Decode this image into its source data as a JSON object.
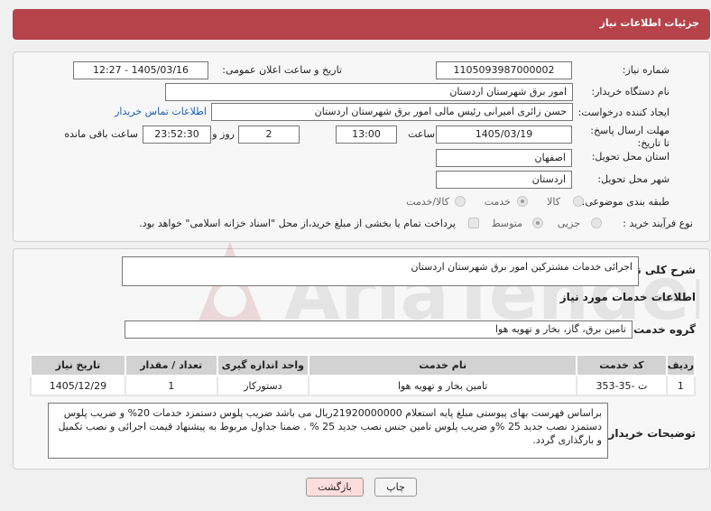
{
  "header": {
    "title": "جزئیات اطلاعات نیاز"
  },
  "form": {
    "need_number_label": "شماره نیاز:",
    "need_number": "1105093987000002",
    "announce_label": "تاریخ و ساعت اعلان عمومی:",
    "announce_value": "1405/03/16 - 12:27",
    "buyer_org_label": "نام دستگاه خریدار:",
    "buyer_org": "امور برق شهرستان اردستان",
    "requester_label": "ایجاد کننده درخواست:",
    "requester": "حسن زائری امیرانی رئیس مالی امور برق شهرستان اردستان",
    "contact_link": "اطلاعات تماس خریدار",
    "deadline_label": "مهلت ارسال پاسخ: تا تاریخ:",
    "deadline_date": "1405/03/19",
    "time_label": "ساعت",
    "deadline_time": "13:00",
    "days_value": "2",
    "days_label": "روز و",
    "remaining_time": "23:52:30",
    "remaining_label": "ساعت باقی مانده",
    "province_label": "استان محل تحویل:",
    "province": "اصفهان",
    "city_label": "شهر محل تحویل:",
    "city": "اردستان",
    "category_label": "طبقه بندی موضوعی:",
    "category_options": [
      "کالا",
      "خدمت",
      "کالا/خدمت"
    ],
    "process_label": "نوع فرآیند خرید :",
    "process_options": [
      "جزیی",
      "متوسط"
    ],
    "payment_text": "پرداخت تمام یا بخشی از مبلغ خرید،از محل \"اسناد خزانه اسلامی\" خواهد بود."
  },
  "summary": {
    "label": "شرح کلی نیاز:",
    "value": "اجرائی خدمات مشترکین امور برق شهرستان اردستان"
  },
  "services": {
    "section_title": "اطلاعات خدمات مورد نیاز",
    "group_label": "گروه خدمت:",
    "group_value": "تامین برق، گاز، بخار و تهویه هوا",
    "columns": [
      "ردیف",
      "کد خدمت",
      "نام خدمت",
      "واحد اندازه گیری",
      "تعداد / مقدار",
      "تاریخ نیاز"
    ],
    "rows": [
      [
        "1",
        "ت -35-353",
        "تامین بخار و تهویه هوا",
        "دستورکار",
        "1",
        "1405/12/29"
      ]
    ]
  },
  "notes": {
    "label": "توضیحات خریدار:",
    "value": "براساس فهرست بهای پیوستی مبلغ پایه استعلام 21920000000ریال می باشد ضریب پلوس دستمزد خدمات 20% و ضریب پلوس دستمزد نصب جدید 25 %و ضریب پلوس تامین جنس نصب جدید 25 % . ضمنا جداول مربوط به پیشنهاد قیمت اجرائی و نصب تکمیل و بارگذاری گردد."
  },
  "buttons": {
    "print": "چاپ",
    "back": "بازگشت"
  },
  "watermark": {
    "text": "AriaTender.neT"
  }
}
